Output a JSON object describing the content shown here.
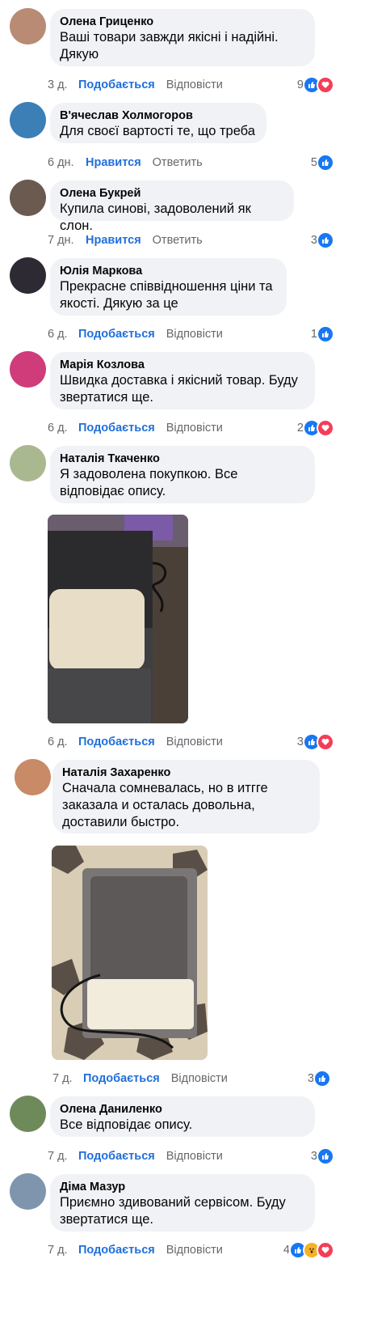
{
  "comments": [
    {
      "author": "Олена Гриценко",
      "text": "Ваші товари завжди якісні і надійні.\nДякую",
      "time": "3 д.",
      "like": "Подобається",
      "reply": "Відповісти",
      "count": "9",
      "reactions": [
        "like-icon",
        "heart-icon"
      ],
      "avatar_color": "#b98b74"
    },
    {
      "author": "В'ячеслав Холмогоров",
      "text": "Для своєї вартості те, що треба",
      "time": "6 дн.",
      "like": "Нравится",
      "reply": "Ответить",
      "count": "5",
      "reactions": [
        "like-icon"
      ],
      "avatar_color": "#3b7fb6"
    },
    {
      "author": "Олена Букрей",
      "text": "Купила синові, задоволений як слон.",
      "time": "7 дн.",
      "like": "Нравится",
      "reply": "Ответить",
      "count": "3",
      "reactions": [
        "like-icon"
      ],
      "avatar_color": "#6b5a50"
    },
    {
      "author": "Юлія Маркова",
      "text": "Прекрасне співвідношення ціни та\nякості. Дякую за це",
      "time": "6 д.",
      "like": "Подобається",
      "reply": "Відповісти",
      "count": "1",
      "reactions": [
        "like-icon"
      ],
      "avatar_color": "#2e2a33"
    },
    {
      "author": "Марія Козлова",
      "text": "Швидка доставка і якісний товар. Буду\nзвертатися ще.",
      "time": "6 д.",
      "like": "Подобається",
      "reply": "Відповісти",
      "count": "2",
      "reactions": [
        "like-icon",
        "heart-icon"
      ],
      "avatar_color": "#d03b7a"
    },
    {
      "author": "Наталія Ткаченко",
      "text": "Я задоволена покупкою. Все\nвідповідає опису.",
      "time": "6 д.",
      "like": "Подобається",
      "reply": "Відповісти",
      "count": "3",
      "reactions": [
        "like-icon",
        "heart-icon"
      ],
      "avatar_color": "#a9b88f"
    },
    {
      "author": "Наталія Захаренко",
      "text": "Сначала сомневалась, но в итгге\nзаказала и осталась довольна,\nдоставили быстро.",
      "time": "7 д.",
      "like": "Подобається",
      "reply": "Відповісти",
      "count": "3",
      "reactions": [
        "like-icon"
      ],
      "avatar_color": "#c98a68"
    },
    {
      "author": "Олена Даниленко",
      "text": "Все відповідає опису.",
      "time": "7 д.",
      "like": "Подобається",
      "reply": "Відповісти",
      "count": "3",
      "reactions": [
        "like-icon"
      ],
      "avatar_color": "#6f8a5a"
    },
    {
      "author": "Діма Мазур",
      "text": "Приємно здивований сервісом. Буду\nзвертатися ще.",
      "time": "7 д.",
      "like": "Подобається",
      "reply": "Відповісти",
      "count": "4",
      "reactions": [
        "like-icon",
        "wow-icon",
        "heart-icon"
      ],
      "avatar_color": "#7f95ad"
    }
  ]
}
